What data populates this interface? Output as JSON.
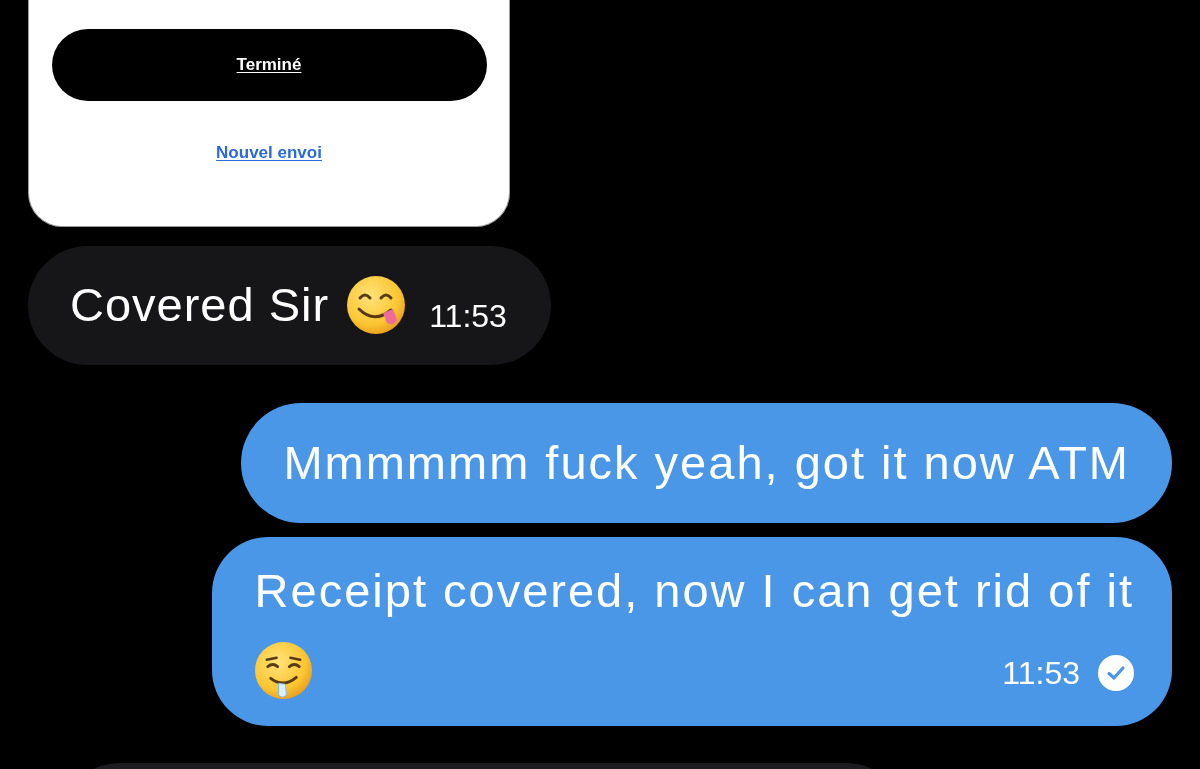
{
  "card": {
    "button": "Terminé",
    "link": "Nouvel envoi"
  },
  "messages": [
    {
      "kind": "received",
      "text": "Covered Sir",
      "time": "11:53"
    },
    {
      "kind": "sent",
      "text": "Mmmmmm fuck yeah, got it now ATM"
    },
    {
      "kind": "sent",
      "text": "Receipt covered, now I can get rid of it",
      "time": "11:53",
      "read": true
    },
    {
      "kind": "received"
    }
  ]
}
